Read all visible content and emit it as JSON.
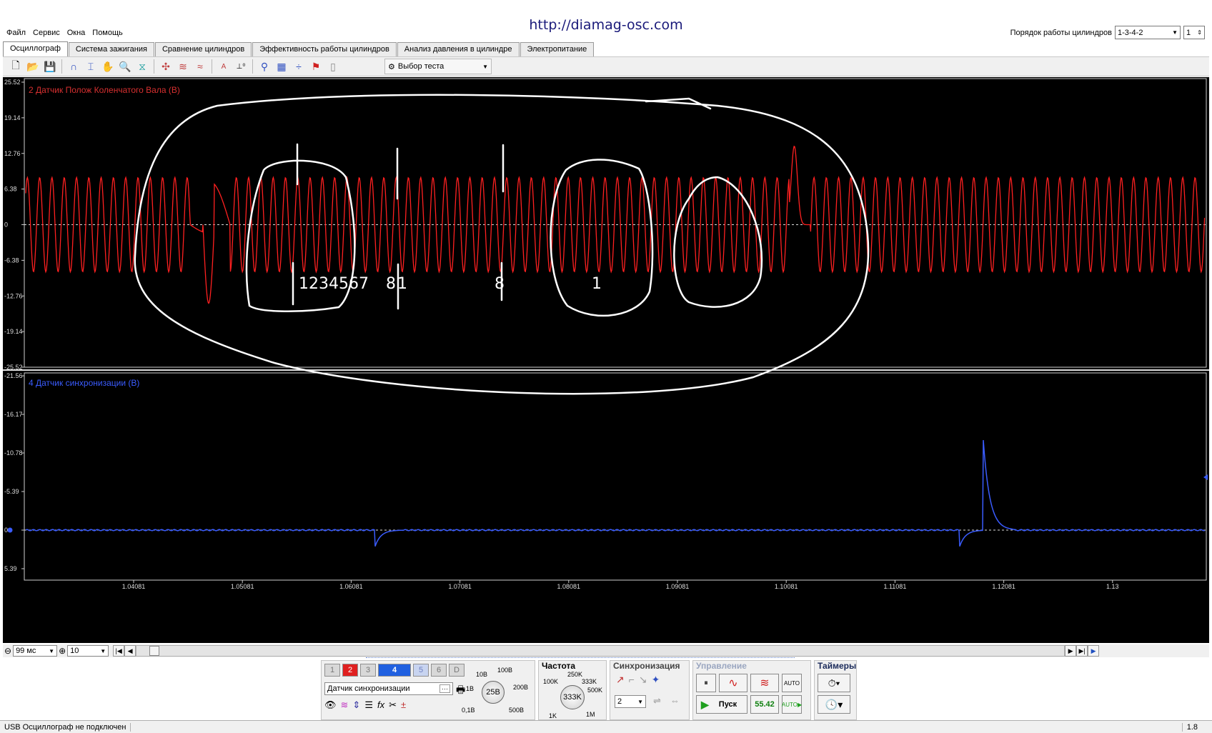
{
  "site_url": "http://diamag-osc.com",
  "menu": [
    "Файл",
    "Сервис",
    "Окна",
    "Помощь"
  ],
  "cylinder_order": {
    "label": "Порядок работы цилиндров",
    "value": "1-3-4-2",
    "count": "1"
  },
  "tabs": [
    {
      "label": "Осциллограф",
      "active": true
    },
    {
      "label": "Система зажигания",
      "active": false
    },
    {
      "label": "Сравнение цилиндров",
      "active": false
    },
    {
      "label": "Эффективность работы цилиндров",
      "active": false
    },
    {
      "label": "Анализ давления в цилиндре",
      "active": false
    },
    {
      "label": "Электропитание",
      "active": false
    }
  ],
  "toolbar": {
    "icons": [
      "new-file-icon",
      "open-folder-icon",
      "save-icon",
      "signal-icon",
      "cursor-icon",
      "hand-icon",
      "zoom-icon",
      "filter-icon",
      "measure-icon",
      "wave-icon",
      "wave-compare-icon",
      "auto-icon",
      "offset-icon",
      "trigger-icon",
      "grid-icon",
      "split-icon",
      "flag-icon",
      "page-icon"
    ],
    "test_select_label": "Выбор теста"
  },
  "scope": {
    "channel_a": {
      "label": "2 Датчик Полож Коленчатого Вала (В)",
      "color": "#ff2020",
      "y_ticks": [
        "25.52",
        "19.14",
        "12.76",
        "6.38",
        "0",
        "-6.38",
        "-12.76",
        "-19.14",
        "-25.52"
      ]
    },
    "channel_b": {
      "label": "4 Датчик синхронизации (В)",
      "color": "#3a5cff",
      "y_ticks": [
        "-21.56",
        "-16.17",
        "-10.78",
        "-5.39",
        "0",
        "5.39"
      ]
    },
    "x_ticks": [
      "1.04081",
      "1.05081",
      "1.06081",
      "1.07081",
      "1.08081",
      "1.09081",
      "1.10081",
      "1.11081",
      "1.12081",
      "1.13"
    ],
    "annotation_marks": [
      "1",
      "2",
      "3",
      "4",
      "5",
      "6",
      "7",
      "8",
      "1",
      "8",
      "1",
      "8"
    ]
  },
  "nav": {
    "time_per_div": "99 мс",
    "zoom_value": "10"
  },
  "control_panel": {
    "channels": [
      "1",
      "2",
      "3",
      "4",
      "5",
      "6",
      "D"
    ],
    "active_channel": "4",
    "sensor_select": "Датчик синхронизации",
    "voltage_knob": {
      "value": "25В",
      "marks": [
        "10В",
        "100В",
        "1В",
        "200В",
        "0,1В",
        "500В"
      ]
    },
    "frequency": {
      "title": "Частота",
      "value": "333K",
      "marks": [
        "250K",
        "100K",
        "333K",
        "500K",
        "1K",
        "1M"
      ]
    },
    "sync": {
      "title": "Синхронизация",
      "value": "2"
    },
    "control": {
      "title": "Управление",
      "start_label": "Пуск",
      "rate": "55.42"
    },
    "timers": {
      "title": "Таймеры"
    }
  },
  "status": {
    "message": "USB Осциллограф не подключен",
    "version": "1.8"
  }
}
